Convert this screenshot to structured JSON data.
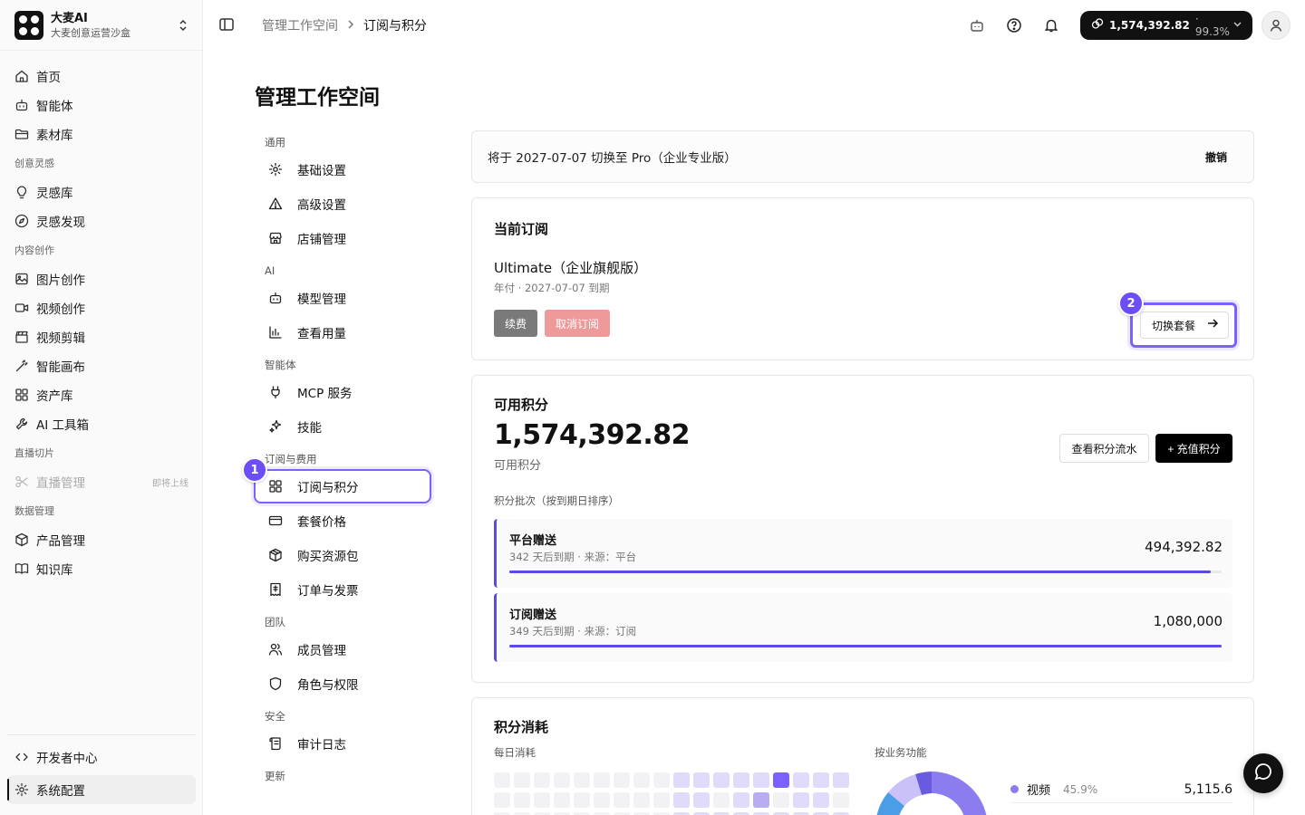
{
  "brand": {
    "name": "大麦AI",
    "subtitle": "大麦创意运营沙盒"
  },
  "sidebar": {
    "top_items": [
      {
        "label": "首页",
        "icon": "home-icon"
      },
      {
        "label": "智能体",
        "icon": "bot-icon"
      },
      {
        "label": "素材库",
        "icon": "folder-icon"
      }
    ],
    "sections": [
      {
        "title": "创意灵感",
        "items": [
          {
            "label": "灵感库",
            "icon": "bulb-icon"
          },
          {
            "label": "灵感发现",
            "icon": "compass-icon"
          }
        ]
      },
      {
        "title": "内容创作",
        "items": [
          {
            "label": "图片创作",
            "icon": "image-icon"
          },
          {
            "label": "视频创作",
            "icon": "video-icon"
          },
          {
            "label": "视频剪辑",
            "icon": "clapper-icon"
          },
          {
            "label": "智能画布",
            "icon": "magic-wand-icon"
          },
          {
            "label": "资产库",
            "icon": "grid-icon"
          },
          {
            "label": "AI 工具箱",
            "icon": "wrench-icon"
          }
        ]
      },
      {
        "title": "直播切片",
        "items": [
          {
            "label": "直播管理",
            "icon": "scissors-icon",
            "badge": "即将上线",
            "disabled": true
          }
        ]
      },
      {
        "title": "数据管理",
        "items": [
          {
            "label": "产品管理",
            "icon": "box-icon"
          },
          {
            "label": "知识库",
            "icon": "book-icon"
          }
        ]
      }
    ],
    "bottom_items": [
      {
        "label": "开发者中心",
        "icon": "code-icon"
      },
      {
        "label": "系统配置",
        "icon": "gear-icon",
        "active": true
      }
    ]
  },
  "topbar": {
    "breadcrumb": [
      "管理工作空间",
      "订阅与积分"
    ],
    "credits": "1,574,392.82",
    "credits_percent": "· 99.3%"
  },
  "page": {
    "title": "管理工作空间"
  },
  "settings_nav": {
    "sections": [
      {
        "title": "通用",
        "items": [
          {
            "label": "基础设置",
            "icon": "gear-icon"
          },
          {
            "label": "高级设置",
            "icon": "warning-icon"
          },
          {
            "label": "店铺管理",
            "icon": "store-icon"
          }
        ]
      },
      {
        "title": "AI",
        "items": [
          {
            "label": "模型管理",
            "icon": "bot-icon"
          },
          {
            "label": "查看用量",
            "icon": "bar-chart-icon"
          }
        ]
      },
      {
        "title": "智能体",
        "items": [
          {
            "label": "MCP 服务",
            "icon": "plug-icon"
          },
          {
            "label": "技能",
            "icon": "sparkles-icon"
          }
        ]
      },
      {
        "title": "订阅与费用",
        "items": [
          {
            "label": "订阅与积分",
            "icon": "dashboard-icon",
            "highlight": true
          },
          {
            "label": "套餐价格",
            "icon": "card-icon"
          },
          {
            "label": "购买资源包",
            "icon": "package-icon"
          },
          {
            "label": "订单与发票",
            "icon": "receipt-icon"
          }
        ]
      },
      {
        "title": "团队",
        "items": [
          {
            "label": "成员管理",
            "icon": "users-icon"
          },
          {
            "label": "角色与权限",
            "icon": "shield-icon"
          }
        ]
      },
      {
        "title": "安全",
        "items": [
          {
            "label": "审计日志",
            "icon": "scroll-icon"
          }
        ]
      },
      {
        "title": "更新",
        "items": []
      }
    ]
  },
  "steps": {
    "one": "1",
    "two": "2"
  },
  "notice": {
    "text": "将于 2027-07-07 切换至 Pro（企业专业版）",
    "action": "撤销"
  },
  "subscription": {
    "heading": "当前订阅",
    "plan": "Ultimate（企业旗舰版）",
    "meta": "年付 · 2027-07-07 到期",
    "renew": "续费",
    "cancel": "取消订阅",
    "switch": "切换套餐"
  },
  "credits_card": {
    "heading": "可用积分",
    "amount": "1,574,392.82",
    "amount_label": "可用积分",
    "flow_button": "查看积分流水",
    "topup_button": "+ 充值积分",
    "batches_label": "积分批次（按到期日排序）",
    "batches": [
      {
        "title": "平台赠送",
        "meta": "342 天后到期 · 来源：平台",
        "amount": "494,392.82",
        "fill": 0.985
      },
      {
        "title": "订阅赠送",
        "meta": "349 天后到期 · 来源：订阅",
        "amount": "1,080,000",
        "fill": 1.0
      }
    ]
  },
  "consumption": {
    "heading": "积分消耗",
    "daily_label": "每日消耗",
    "by_feature_label": "按业务功能",
    "heat_levels": [
      [
        0,
        0,
        0,
        0,
        0,
        0,
        0,
        0,
        0,
        1,
        1,
        1,
        1,
        1,
        3,
        1,
        1,
        1
      ],
      [
        0,
        0,
        0,
        0,
        0,
        0,
        0,
        0,
        0,
        1,
        1,
        0,
        1,
        2,
        0,
        1,
        1,
        0
      ],
      [
        0,
        0,
        0,
        0,
        0,
        0,
        0,
        0,
        0,
        1,
        1,
        1,
        1,
        1,
        1,
        1,
        1,
        1
      ]
    ],
    "legend": [
      {
        "label": "视频",
        "percent": "45.9%",
        "value": "5,115.6"
      }
    ]
  },
  "colors": {
    "accent": "#7b61ff",
    "primary_dark": "#111111",
    "batch_bar": "#5b4be0"
  }
}
